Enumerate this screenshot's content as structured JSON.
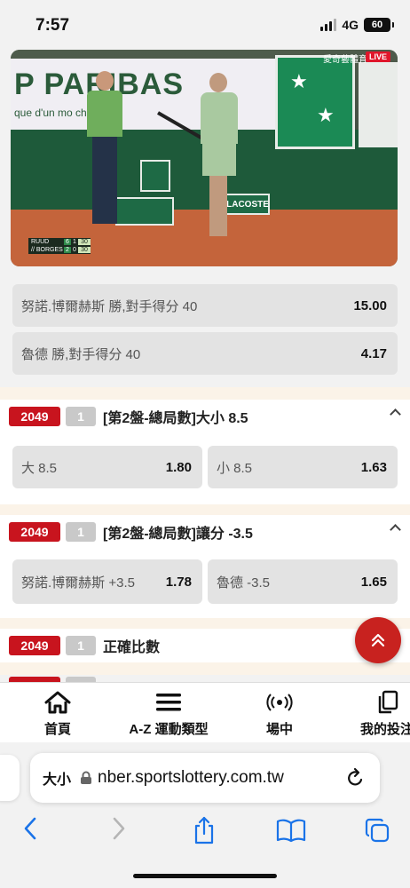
{
  "status_bar": {
    "time": "7:57",
    "network": "4G",
    "battery": "60"
  },
  "video": {
    "banner_text": "P PARIBAS",
    "banner_subtext": "que d'un mo          change",
    "sign_lacoste": "LACOSTE",
    "watermark": "愛奇藝體育",
    "live_badge": "LIVE",
    "scoreboard": [
      {
        "player": "RUUD",
        "sets": [
          "6",
          "1"
        ],
        "points": "30"
      },
      {
        "player": "// BORGES",
        "sets": [
          "2",
          "0"
        ],
        "points": "30"
      }
    ]
  },
  "markets_top": [
    {
      "label": "努諾.博爾赫斯 勝,對手得分 40",
      "odds": "15.00"
    },
    {
      "label": "魯德 勝,對手得分 40",
      "odds": "4.17"
    }
  ],
  "markets": [
    {
      "code": "2049",
      "set": "1",
      "title": "[第2盤-總局數]大小 8.5",
      "options": [
        {
          "label": "大 8.5",
          "odds": "1.80"
        },
        {
          "label": "小 8.5",
          "odds": "1.63"
        }
      ]
    },
    {
      "code": "2049",
      "set": "1",
      "title": "[第2盤-總局數]讓分 -3.5",
      "options": [
        {
          "label": "努諾.博爾赫斯 +3.5",
          "odds": "1.78"
        },
        {
          "label": "魯德 -3.5",
          "odds": "1.65"
        }
      ]
    },
    {
      "code": "2049",
      "set": "1",
      "title": "正確比數",
      "options": []
    }
  ],
  "bottom_nav": [
    {
      "label": "首頁",
      "icon": "home-icon"
    },
    {
      "label": "A-Z 運動類型",
      "icon": "menu-icon"
    },
    {
      "label": "場中",
      "icon": "live-broadcast-icon"
    },
    {
      "label": "我的投注",
      "icon": "copy-icon"
    }
  ],
  "browser": {
    "aa_label": "大小",
    "url": "nber.sportslottery.com.tw"
  },
  "colors": {
    "accent_red": "#c8141e",
    "odds_bg": "#e3e3e3",
    "divider_cream": "#fbf3e8"
  }
}
